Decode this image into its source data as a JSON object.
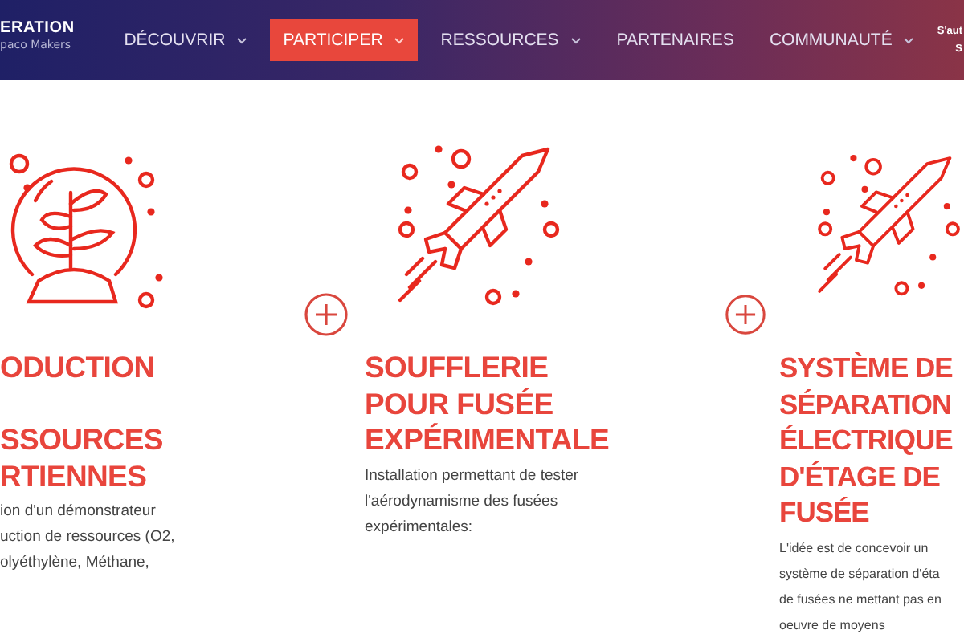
{
  "header": {
    "logo": {
      "title": "ERATION",
      "subtitle": "paco Makers"
    },
    "nav": [
      {
        "label": "DÉCOUVRIR",
        "dropdown": true,
        "selected": false
      },
      {
        "label": "PARTICIPER",
        "dropdown": true,
        "selected": true
      },
      {
        "label": "RESSOURCES",
        "dropdown": true,
        "selected": false
      },
      {
        "label": "PARTENAIRES",
        "dropdown": false,
        "selected": false
      },
      {
        "label": "COMMUNAUTÉ",
        "dropdown": true,
        "selected": false
      }
    ],
    "account": [
      "S'aut",
      "S"
    ]
  },
  "projects": [
    {
      "kind": "plant",
      "heading": [
        [
          "ODUCTION"
        ],
        [
          "SSOURCES",
          "RTIENNES"
        ]
      ],
      "body": [
        "ion d'un démonstrateur",
        "uction de ressources (O2,",
        "olyéthylène, Méthane,"
      ]
    },
    {
      "kind": "rocket",
      "heading": [
        [
          "SOUFFLERIE",
          "POUR FUSÉE",
          "EXPÉRIMENTALE"
        ]
      ],
      "body": [
        "Installation permettant de tester",
        "l'aérodynamisme des fusées",
        "expérimentales:"
      ]
    },
    {
      "kind": "rocket",
      "heading": [
        [
          "SYSTÈME DE",
          "SÉPARATION",
          "ÉLECTRIQUE",
          "D'ÉTAGE DE",
          "FUSÉE"
        ]
      ],
      "body": [
        "L'idée est de concevoir un",
        "système de séparation d'éta",
        "de fusées ne mettant pas en",
        "oeuvre de moyens"
      ]
    }
  ]
}
